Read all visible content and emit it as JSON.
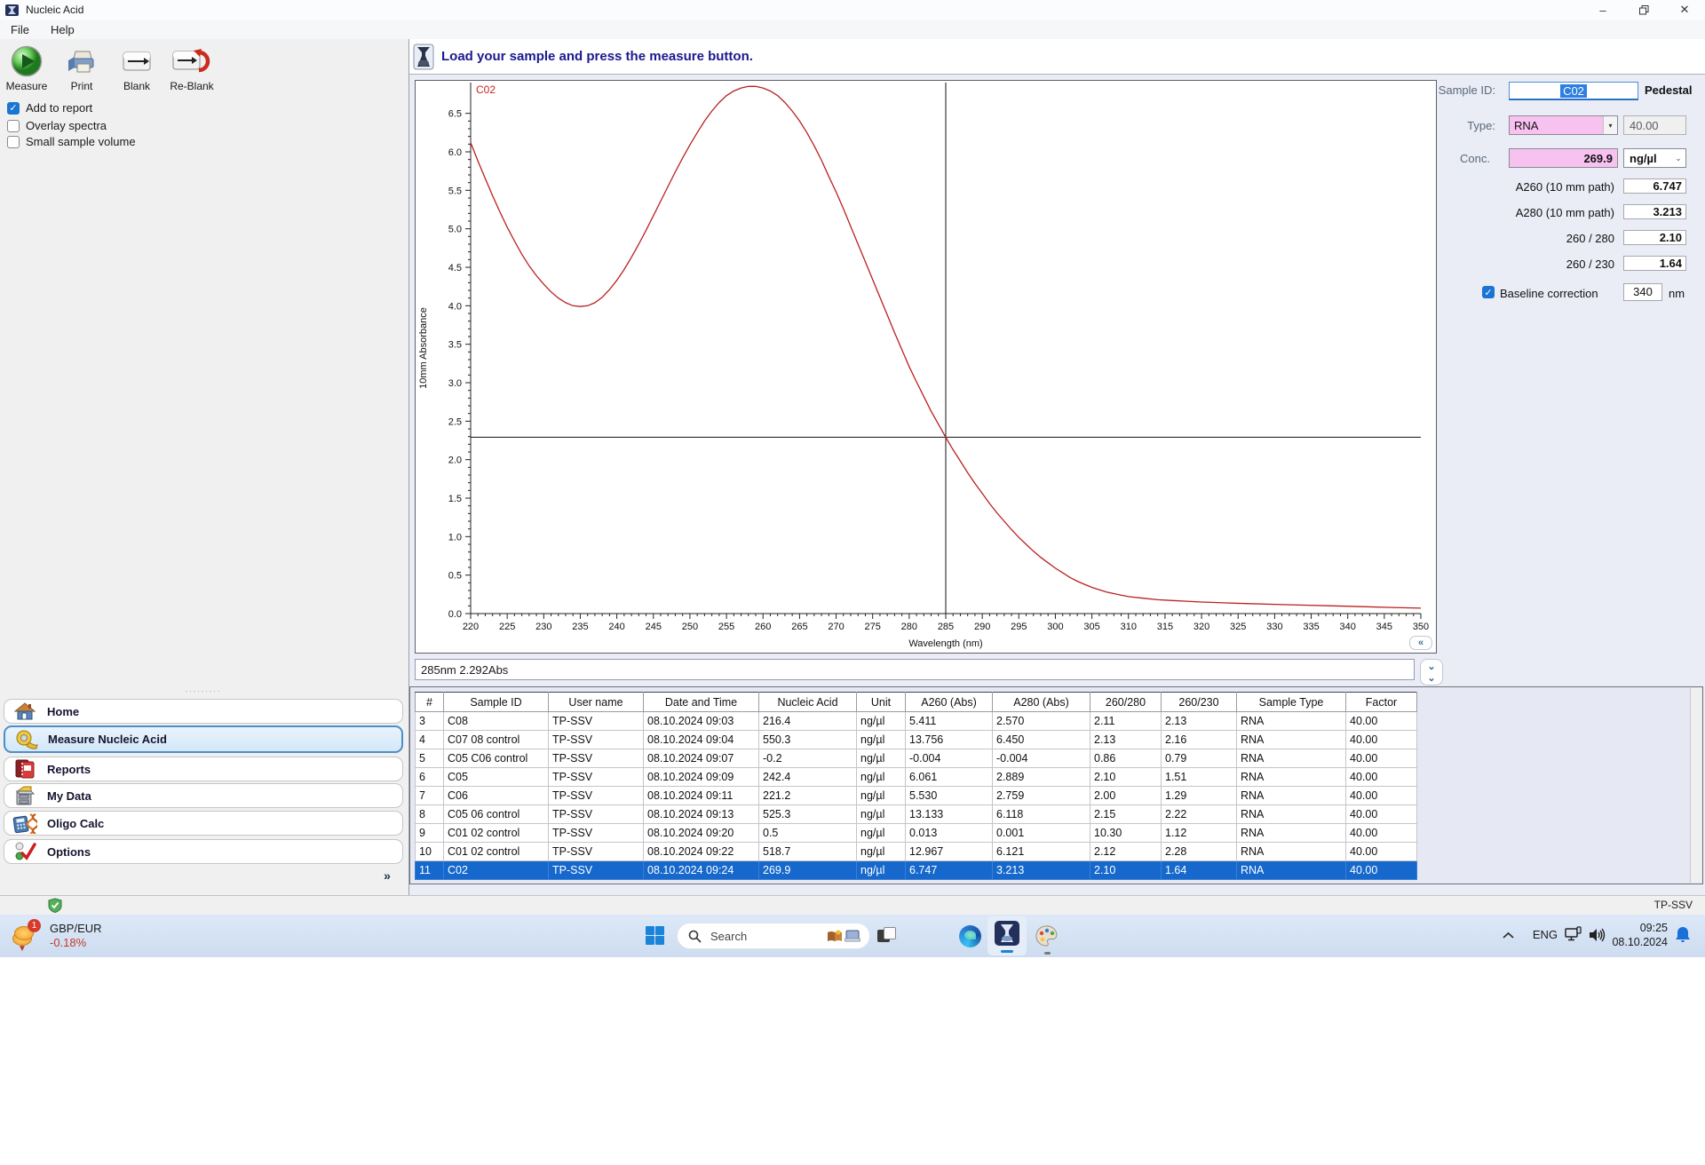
{
  "colors": {
    "header_navy": "#1a1a8f",
    "selected_row": "#1668cc",
    "selection_blue": "#2f7fe0",
    "field_pink": "#f8c2f0",
    "curve_red": "#bb1f1f",
    "change_red": "#c0392b"
  },
  "window": {
    "title": "Nucleic Acid"
  },
  "menu": {
    "items": [
      {
        "label": "File"
      },
      {
        "label": "Help"
      }
    ]
  },
  "toolbar": {
    "buttons": [
      {
        "label": "Measure"
      },
      {
        "label": "Print"
      },
      {
        "label": "Blank"
      },
      {
        "label": "Re-Blank"
      }
    ]
  },
  "checkboxes": [
    {
      "label": "Add to report",
      "checked": true
    },
    {
      "label": "Overlay spectra",
      "checked": false
    },
    {
      "label": "Small sample volume",
      "checked": false
    }
  ],
  "sidebar": {
    "items": [
      {
        "label": "Home",
        "selected": false
      },
      {
        "label": "Measure Nucleic Acid",
        "selected": true
      },
      {
        "label": "Reports",
        "selected": false
      },
      {
        "label": "My Data",
        "selected": false
      },
      {
        "label": "Oligo Calc",
        "selected": false
      },
      {
        "label": "Options",
        "selected": false
      }
    ],
    "more_chevron": "»"
  },
  "header": {
    "message": "Load your sample and press the measure button."
  },
  "chart_data": {
    "type": "line",
    "title": "C02",
    "xlabel": "Wavelength (nm)",
    "ylabel": "10mm Absorbance",
    "xlim": [
      220,
      350
    ],
    "ylim": [
      0,
      6.9
    ],
    "x_major_tick": 5,
    "x_minor_tick": 1,
    "y_major_tick": 0.5,
    "y_minor_tick": 0.1,
    "y_axis_max_label": 6.5,
    "grid": false,
    "legend_position": "none",
    "cursor": {
      "x": 285,
      "y": 2.292,
      "readout": "285nm 2.292Abs"
    },
    "series": [
      {
        "name": "C02",
        "points": [
          [
            220,
            6.12
          ],
          [
            221,
            5.88
          ],
          [
            222,
            5.65
          ],
          [
            223,
            5.43
          ],
          [
            224,
            5.22
          ],
          [
            225,
            5.02
          ],
          [
            226,
            4.84
          ],
          [
            227,
            4.67
          ],
          [
            228,
            4.52
          ],
          [
            229,
            4.39
          ],
          [
            230,
            4.28
          ],
          [
            231,
            4.18
          ],
          [
            232,
            4.1
          ],
          [
            233,
            4.04
          ],
          [
            234,
            4.0
          ],
          [
            235,
            3.99
          ],
          [
            236,
            4.0
          ],
          [
            237,
            4.04
          ],
          [
            238,
            4.11
          ],
          [
            239,
            4.21
          ],
          [
            240,
            4.33
          ],
          [
            241,
            4.47
          ],
          [
            242,
            4.63
          ],
          [
            243,
            4.8
          ],
          [
            244,
            4.98
          ],
          [
            245,
            5.17
          ],
          [
            246,
            5.36
          ],
          [
            247,
            5.55
          ],
          [
            248,
            5.74
          ],
          [
            249,
            5.92
          ],
          [
            250,
            6.09
          ],
          [
            251,
            6.25
          ],
          [
            252,
            6.4
          ],
          [
            253,
            6.53
          ],
          [
            254,
            6.64
          ],
          [
            255,
            6.73
          ],
          [
            256,
            6.79
          ],
          [
            257,
            6.83
          ],
          [
            258,
            6.85
          ],
          [
            259,
            6.85
          ],
          [
            260,
            6.83
          ],
          [
            261,
            6.79
          ],
          [
            262,
            6.73
          ],
          [
            263,
            6.64
          ],
          [
            264,
            6.53
          ],
          [
            265,
            6.4
          ],
          [
            266,
            6.25
          ],
          [
            267,
            6.08
          ],
          [
            268,
            5.89
          ],
          [
            269,
            5.68
          ],
          [
            270,
            5.48
          ],
          [
            271,
            5.26
          ],
          [
            272,
            5.03
          ],
          [
            273,
            4.8
          ],
          [
            274,
            4.57
          ],
          [
            275,
            4.34
          ],
          [
            276,
            4.11
          ],
          [
            277,
            3.88
          ],
          [
            278,
            3.65
          ],
          [
            279,
            3.43
          ],
          [
            280,
            3.21
          ],
          [
            281,
            3.01
          ],
          [
            282,
            2.82
          ],
          [
            283,
            2.63
          ],
          [
            284,
            2.46
          ],
          [
            285,
            2.292
          ],
          [
            286,
            2.13
          ],
          [
            287,
            1.98
          ],
          [
            288,
            1.83
          ],
          [
            289,
            1.69
          ],
          [
            290,
            1.56
          ],
          [
            291,
            1.43
          ],
          [
            292,
            1.31
          ],
          [
            293,
            1.2
          ],
          [
            294,
            1.09
          ],
          [
            295,
            0.99
          ],
          [
            296,
            0.9
          ],
          [
            297,
            0.81
          ],
          [
            298,
            0.73
          ],
          [
            299,
            0.66
          ],
          [
            300,
            0.59
          ],
          [
            301,
            0.53
          ],
          [
            302,
            0.47
          ],
          [
            303,
            0.42
          ],
          [
            304,
            0.38
          ],
          [
            305,
            0.34
          ],
          [
            306,
            0.31
          ],
          [
            307,
            0.28
          ],
          [
            308,
            0.26
          ],
          [
            309,
            0.24
          ],
          [
            310,
            0.22
          ],
          [
            312,
            0.2
          ],
          [
            314,
            0.18
          ],
          [
            316,
            0.17
          ],
          [
            318,
            0.16
          ],
          [
            320,
            0.15
          ],
          [
            323,
            0.14
          ],
          [
            326,
            0.13
          ],
          [
            330,
            0.12
          ],
          [
            334,
            0.11
          ],
          [
            338,
            0.1
          ],
          [
            342,
            0.09
          ],
          [
            346,
            0.08
          ],
          [
            350,
            0.07
          ]
        ]
      }
    ]
  },
  "sample_panel": {
    "sample_id_label": "Sample ID:",
    "sample_id_value": "C02",
    "mode": "Pedestal",
    "type_label": "Type:",
    "type_value": "RNA",
    "factor_value": "40.00",
    "conc_label": "Conc.",
    "conc_value": "269.9",
    "conc_unit": "ng/µl",
    "rows": [
      {
        "label": "A260 (10 mm path)",
        "value": "6.747"
      },
      {
        "label": "A280 (10 mm path)",
        "value": "3.213"
      },
      {
        "label": "260 / 280",
        "value": "2.10"
      },
      {
        "label": "260 / 230",
        "value": "1.64"
      }
    ],
    "baseline_label": "Baseline correction",
    "baseline_checked": true,
    "baseline_value": "340",
    "baseline_unit": "nm"
  },
  "results_table": {
    "columns": [
      "#",
      "Sample ID",
      "User name",
      "Date and Time",
      "Nucleic Acid",
      "Unit",
      "A260 (Abs)",
      "A280 (Abs)",
      "260/280",
      "260/230",
      "Sample Type",
      "Factor"
    ],
    "selected_row_index": 8,
    "rows": [
      [
        "3",
        "C08",
        "TP-SSV",
        "08.10.2024 09:03",
        "216.4",
        "ng/µl",
        "5.411",
        "2.570",
        "2.11",
        "2.13",
        "RNA",
        "40.00"
      ],
      [
        "4",
        "C07 08 control",
        "TP-SSV",
        "08.10.2024 09:04",
        "550.3",
        "ng/µl",
        "13.756",
        "6.450",
        "2.13",
        "2.16",
        "RNA",
        "40.00"
      ],
      [
        "5",
        "C05 C06 control",
        "TP-SSV",
        "08.10.2024 09:07",
        "-0.2",
        "ng/µl",
        "-0.004",
        "-0.004",
        "0.86",
        "0.79",
        "RNA",
        "40.00"
      ],
      [
        "6",
        "C05",
        "TP-SSV",
        "08.10.2024 09:09",
        "242.4",
        "ng/µl",
        "6.061",
        "2.889",
        "2.10",
        "1.51",
        "RNA",
        "40.00"
      ],
      [
        "7",
        "C06",
        "TP-SSV",
        "08.10.2024 09:11",
        "221.2",
        "ng/µl",
        "5.530",
        "2.759",
        "2.00",
        "1.29",
        "RNA",
        "40.00"
      ],
      [
        "8",
        "C05 06 control",
        "TP-SSV",
        "08.10.2024 09:13",
        "525.3",
        "ng/µl",
        "13.133",
        "6.118",
        "2.15",
        "2.22",
        "RNA",
        "40.00"
      ],
      [
        "9",
        "C01 02 control",
        "TP-SSV",
        "08.10.2024 09:20",
        "0.5",
        "ng/µl",
        "0.013",
        "0.001",
        "10.30",
        "1.12",
        "RNA",
        "40.00"
      ],
      [
        "10",
        "C01 02 control",
        "TP-SSV",
        "08.10.2024 09:22",
        "518.7",
        "ng/µl",
        "12.967",
        "6.121",
        "2.12",
        "2.28",
        "RNA",
        "40.00"
      ],
      [
        "11",
        "C02",
        "TP-SSV",
        "08.10.2024 09:24",
        "269.9",
        "ng/µl",
        "6.747",
        "3.213",
        "2.10",
        "1.64",
        "RNA",
        "40.00"
      ]
    ]
  },
  "status_bar": {
    "user": "TP-SSV"
  },
  "taskbar": {
    "widget": {
      "title": "GBP/EUR",
      "change": "-0.18%",
      "badge": "1"
    },
    "search_placeholder": "Search",
    "tray": {
      "lang": "ENG",
      "time": "09:25",
      "date": "08.10.2024"
    }
  }
}
